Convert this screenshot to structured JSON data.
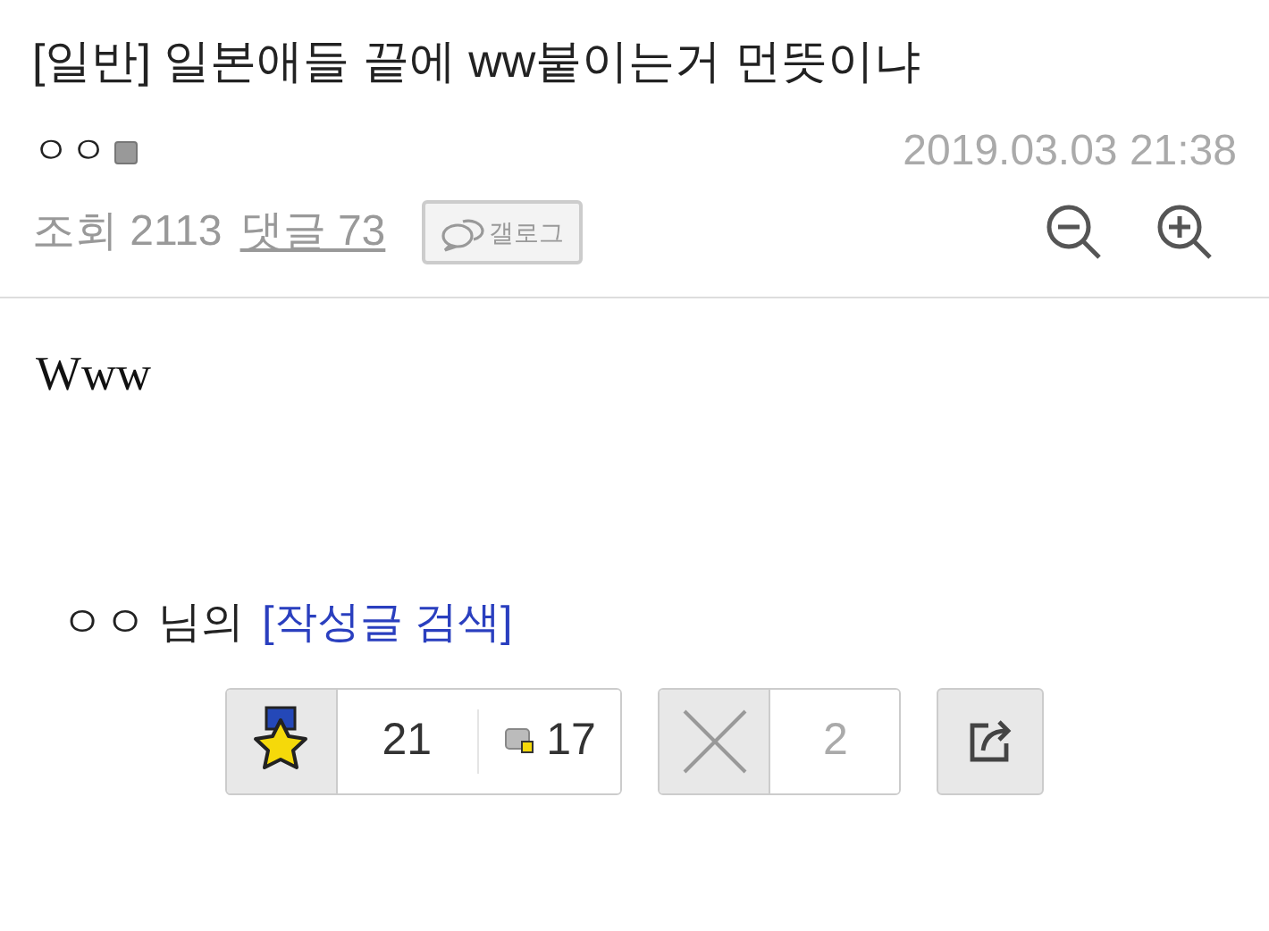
{
  "post": {
    "title": "[일반] 일본애들 끝에 ww붙이는거 먼뜻이냐",
    "author": "ㅇㅇ",
    "date": "2019.03.03 21:38",
    "views_label": "조회 2113",
    "comments_link": "댓글 73",
    "gallog_button": "갤로그",
    "body": "Www"
  },
  "author_search": {
    "name": "ㅇㅇ 님의",
    "link": "[작성글 검색]"
  },
  "votes": {
    "up_count": "21",
    "fixed_count": "17",
    "down_count": "2"
  }
}
